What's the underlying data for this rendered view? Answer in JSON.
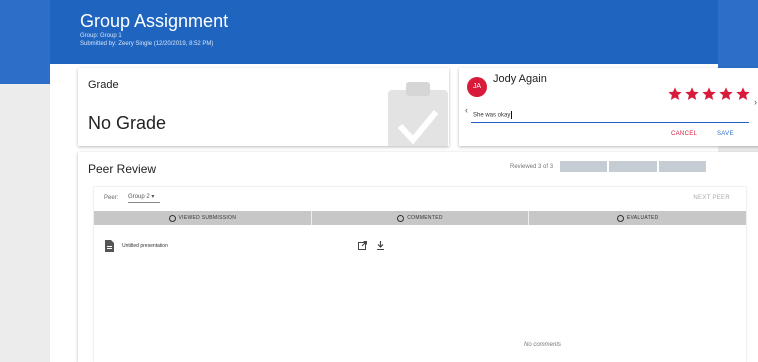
{
  "header": {
    "title": "Group Assignment",
    "group_line": "Group: Group 1",
    "submitted_line": "Submitted by: Zeery Single (12/20/2019, 8:52 PM)"
  },
  "grade": {
    "label": "Grade",
    "value": "No Grade"
  },
  "comment": {
    "avatar_initials": "JA",
    "author": "Jody Again",
    "rating": 5,
    "rating_max": 5,
    "text": "She was okay",
    "cancel_label": "CANCEL",
    "save_label": "SAVE",
    "star_color": "#d81b3a"
  },
  "peer_review": {
    "title": "Peer Review",
    "reviewed_text": "Reviewed 3 of 3",
    "peer_label": "Peer:",
    "peer_value": "Group 2",
    "next_peer_label": "NEXT PEER",
    "statuses": [
      "VIEWED SUBMISSION",
      "COMMENTED",
      "EVALUATED"
    ],
    "file_name": "Untitled presentation",
    "no_comments_text": "No comments"
  },
  "colors": {
    "header_bg": "#1f65c0",
    "accent_red": "#d81b3a",
    "accent_blue": "#2d6fc8"
  }
}
